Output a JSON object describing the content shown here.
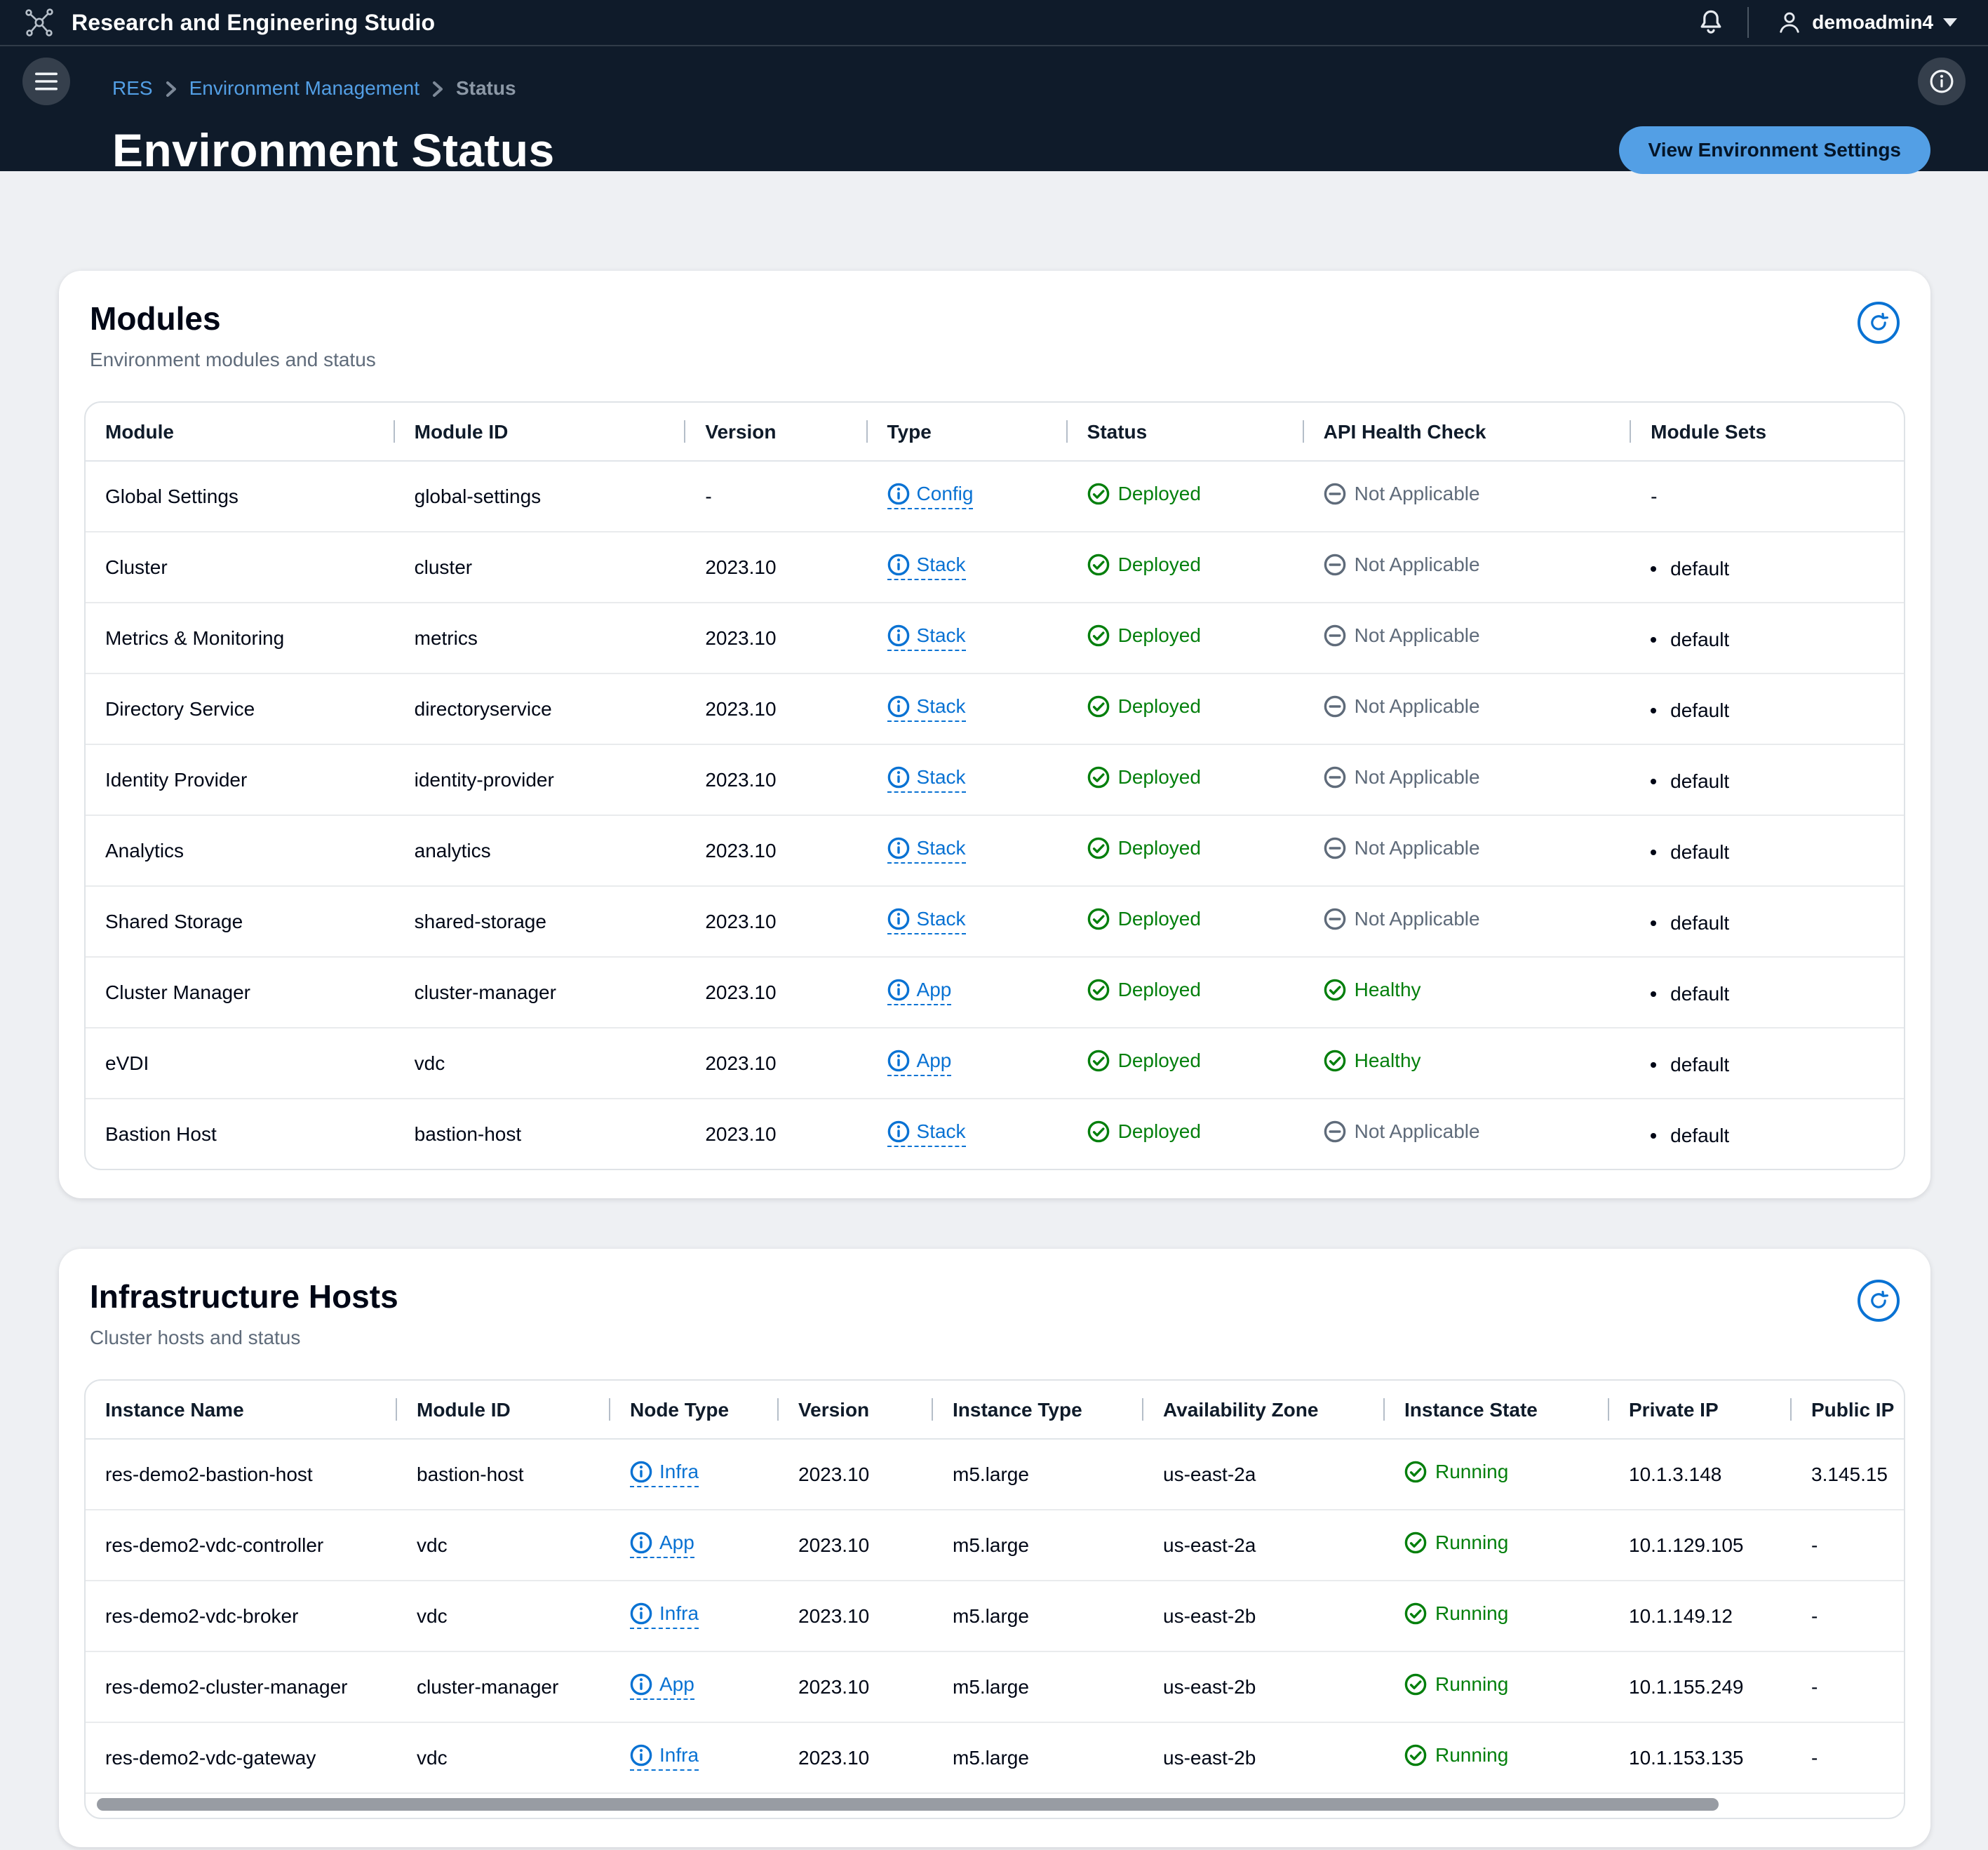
{
  "topnav": {
    "title": "Research and Engineering Studio",
    "user": "demoadmin4"
  },
  "breadcrumb": {
    "items": [
      {
        "label": "RES"
      },
      {
        "label": "Environment Management"
      },
      {
        "label": "Status"
      }
    ]
  },
  "page": {
    "title": "Environment Status",
    "settings_button": "View Environment Settings"
  },
  "modules_card": {
    "title": "Modules",
    "subtitle": "Environment modules and status",
    "columns": [
      "Module",
      "Module ID",
      "Version",
      "Type",
      "Status",
      "API Health Check",
      "Module Sets"
    ],
    "rows": [
      [
        {
          "text": "Global Settings"
        },
        {
          "text": "global-settings"
        },
        {
          "text": "-"
        },
        {
          "link": "Config"
        },
        {
          "status": "Deployed",
          "state": "success"
        },
        {
          "status": "Not Applicable",
          "state": "neutral"
        },
        {
          "text": "-"
        }
      ],
      [
        {
          "text": "Cluster"
        },
        {
          "text": "cluster"
        },
        {
          "text": "2023.10"
        },
        {
          "link": "Stack"
        },
        {
          "status": "Deployed",
          "state": "success"
        },
        {
          "status": "Not Applicable",
          "state": "neutral"
        },
        {
          "bullet": "default"
        }
      ],
      [
        {
          "text": "Metrics & Monitoring"
        },
        {
          "text": "metrics"
        },
        {
          "text": "2023.10"
        },
        {
          "link": "Stack"
        },
        {
          "status": "Deployed",
          "state": "success"
        },
        {
          "status": "Not Applicable",
          "state": "neutral"
        },
        {
          "bullet": "default"
        }
      ],
      [
        {
          "text": "Directory Service"
        },
        {
          "text": "directoryservice"
        },
        {
          "text": "2023.10"
        },
        {
          "link": "Stack"
        },
        {
          "status": "Deployed",
          "state": "success"
        },
        {
          "status": "Not Applicable",
          "state": "neutral"
        },
        {
          "bullet": "default"
        }
      ],
      [
        {
          "text": "Identity Provider"
        },
        {
          "text": "identity-provider"
        },
        {
          "text": "2023.10"
        },
        {
          "link": "Stack"
        },
        {
          "status": "Deployed",
          "state": "success"
        },
        {
          "status": "Not Applicable",
          "state": "neutral"
        },
        {
          "bullet": "default"
        }
      ],
      [
        {
          "text": "Analytics"
        },
        {
          "text": "analytics"
        },
        {
          "text": "2023.10"
        },
        {
          "link": "Stack"
        },
        {
          "status": "Deployed",
          "state": "success"
        },
        {
          "status": "Not Applicable",
          "state": "neutral"
        },
        {
          "bullet": "default"
        }
      ],
      [
        {
          "text": "Shared Storage"
        },
        {
          "text": "shared-storage"
        },
        {
          "text": "2023.10"
        },
        {
          "link": "Stack"
        },
        {
          "status": "Deployed",
          "state": "success"
        },
        {
          "status": "Not Applicable",
          "state": "neutral"
        },
        {
          "bullet": "default"
        }
      ],
      [
        {
          "text": "Cluster Manager"
        },
        {
          "text": "cluster-manager"
        },
        {
          "text": "2023.10"
        },
        {
          "link": "App"
        },
        {
          "status": "Deployed",
          "state": "success"
        },
        {
          "status": "Healthy",
          "state": "success"
        },
        {
          "bullet": "default"
        }
      ],
      [
        {
          "text": "eVDI"
        },
        {
          "text": "vdc"
        },
        {
          "text": "2023.10"
        },
        {
          "link": "App"
        },
        {
          "status": "Deployed",
          "state": "success"
        },
        {
          "status": "Healthy",
          "state": "success"
        },
        {
          "bullet": "default"
        }
      ],
      [
        {
          "text": "Bastion Host"
        },
        {
          "text": "bastion-host"
        },
        {
          "text": "2023.10"
        },
        {
          "link": "Stack"
        },
        {
          "status": "Deployed",
          "state": "success"
        },
        {
          "status": "Not Applicable",
          "state": "neutral"
        },
        {
          "bullet": "default"
        }
      ]
    ]
  },
  "hosts_card": {
    "title": "Infrastructure Hosts",
    "subtitle": "Cluster hosts and status",
    "columns": [
      "Instance Name",
      "Module ID",
      "Node Type",
      "Version",
      "Instance Type",
      "Availability Zone",
      "Instance State",
      "Private IP",
      "Public IP"
    ],
    "rows": [
      [
        {
          "text": "res-demo2-bastion-host"
        },
        {
          "text": "bastion-host"
        },
        {
          "link": "Infra"
        },
        {
          "text": "2023.10"
        },
        {
          "text": "m5.large"
        },
        {
          "text": "us-east-2a"
        },
        {
          "status": "Running",
          "state": "success"
        },
        {
          "text": "10.1.3.148"
        },
        {
          "text": "3.145.15"
        }
      ],
      [
        {
          "text": "res-demo2-vdc-controller"
        },
        {
          "text": "vdc"
        },
        {
          "link": "App"
        },
        {
          "text": "2023.10"
        },
        {
          "text": "m5.large"
        },
        {
          "text": "us-east-2a"
        },
        {
          "status": "Running",
          "state": "success"
        },
        {
          "text": "10.1.129.105"
        },
        {
          "text": "-"
        }
      ],
      [
        {
          "text": "res-demo2-vdc-broker"
        },
        {
          "text": "vdc"
        },
        {
          "link": "Infra"
        },
        {
          "text": "2023.10"
        },
        {
          "text": "m5.large"
        },
        {
          "text": "us-east-2b"
        },
        {
          "status": "Running",
          "state": "success"
        },
        {
          "text": "10.1.149.12"
        },
        {
          "text": "-"
        }
      ],
      [
        {
          "text": "res-demo2-cluster-manager"
        },
        {
          "text": "cluster-manager"
        },
        {
          "link": "App"
        },
        {
          "text": "2023.10"
        },
        {
          "text": "m5.large"
        },
        {
          "text": "us-east-2b"
        },
        {
          "status": "Running",
          "state": "success"
        },
        {
          "text": "10.1.155.249"
        },
        {
          "text": "-"
        }
      ],
      [
        {
          "text": "res-demo2-vdc-gateway"
        },
        {
          "text": "vdc"
        },
        {
          "link": "Infra"
        },
        {
          "text": "2023.10"
        },
        {
          "text": "m5.large"
        },
        {
          "text": "us-east-2b"
        },
        {
          "status": "Running",
          "state": "success"
        },
        {
          "text": "10.1.153.135"
        },
        {
          "text": "-"
        }
      ]
    ]
  },
  "colors": {
    "dark": "#0f1b2a",
    "pagebg": "#eef0f3",
    "accent": "#0972d3",
    "success": "#037f0c",
    "neutral": "#5f6b7a",
    "btnbg": "#539fe5",
    "btntext": "#041528"
  }
}
